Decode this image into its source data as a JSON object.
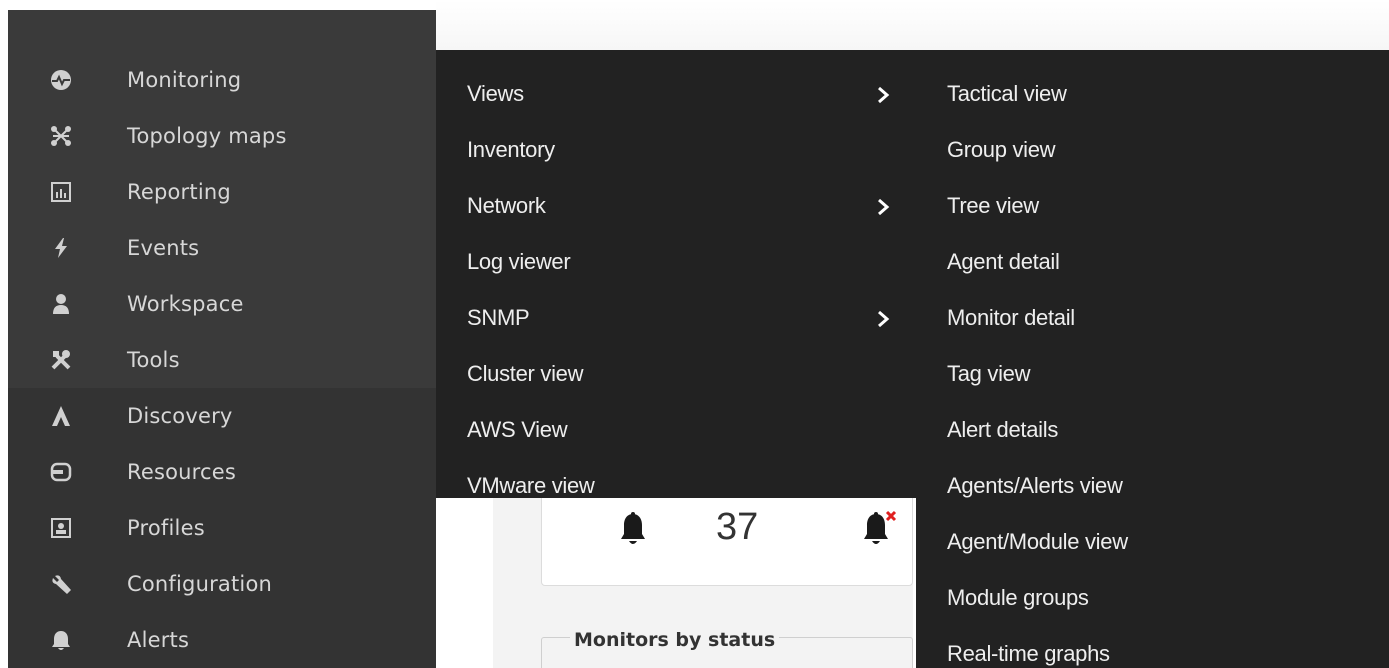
{
  "sidebar": {
    "items": [
      {
        "label": "Monitoring",
        "icon": "monitoring-icon"
      },
      {
        "label": "Topology maps",
        "icon": "topology-icon"
      },
      {
        "label": "Reporting",
        "icon": "reporting-icon"
      },
      {
        "label": "Events",
        "icon": "lightning-icon"
      },
      {
        "label": "Workspace",
        "icon": "user-icon"
      },
      {
        "label": "Tools",
        "icon": "tools-icon"
      },
      {
        "label": "Discovery",
        "icon": "discovery-icon"
      },
      {
        "label": "Resources",
        "icon": "resources-icon"
      },
      {
        "label": "Profiles",
        "icon": "profile-card-icon"
      },
      {
        "label": "Configuration",
        "icon": "wrench-icon"
      },
      {
        "label": "Alerts",
        "icon": "bell-icon"
      }
    ]
  },
  "submenu": {
    "items": [
      {
        "label": "Views",
        "has_children": true
      },
      {
        "label": "Inventory",
        "has_children": false
      },
      {
        "label": "Network",
        "has_children": true
      },
      {
        "label": "Log viewer",
        "has_children": false
      },
      {
        "label": "SNMP",
        "has_children": true
      },
      {
        "label": "Cluster view",
        "has_children": false
      },
      {
        "label": "AWS View",
        "has_children": false
      },
      {
        "label": "VMware view",
        "has_children": false
      }
    ]
  },
  "views_submenu": {
    "items": [
      {
        "label": "Tactical view"
      },
      {
        "label": "Group view"
      },
      {
        "label": "Tree view"
      },
      {
        "label": "Agent detail"
      },
      {
        "label": "Monitor detail"
      },
      {
        "label": "Tag view"
      },
      {
        "label": "Alert details"
      },
      {
        "label": "Agents/Alerts view"
      },
      {
        "label": "Agent/Module view"
      },
      {
        "label": "Module groups"
      },
      {
        "label": "Real-time graphs"
      }
    ]
  },
  "background": {
    "alerts_count": "37",
    "monitors_legend": "Monitors by status"
  },
  "colors": {
    "sidebar_bg": "#333333",
    "sidebar_active_bg": "#3a3a3a",
    "menu_bg": "#222222",
    "menu_text": "#eeeeee",
    "alert_red": "#e02020"
  }
}
